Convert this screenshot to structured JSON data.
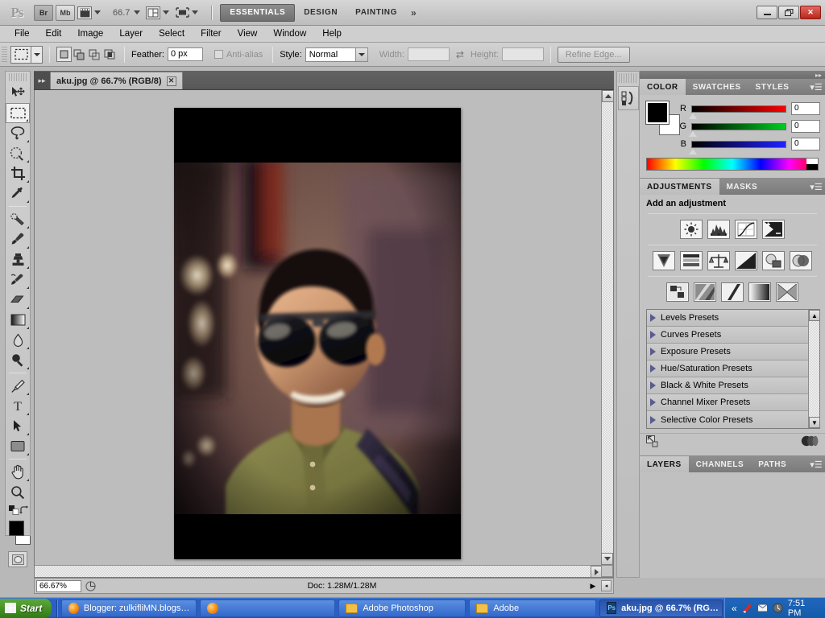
{
  "app": {
    "logo": "Ps",
    "quick_buttons": [
      {
        "name": "bridge",
        "label": "Br"
      },
      {
        "name": "mini-bridge",
        "label": "Mb"
      }
    ],
    "view_extras_label": "",
    "zoom_level": "66.7",
    "workspaces": [
      {
        "label": "ESSENTIALS",
        "active": true
      },
      {
        "label": "DESIGN",
        "active": false
      },
      {
        "label": "PAINTING",
        "active": false
      }
    ],
    "workspace_overflow": "»",
    "window_controls": {
      "minimize": "–",
      "restore": "❐",
      "close": "✕"
    }
  },
  "menubar": {
    "items": [
      "File",
      "Edit",
      "Image",
      "Layer",
      "Select",
      "Filter",
      "View",
      "Window",
      "Help"
    ]
  },
  "options_bar": {
    "tool": "rectangular-marquee",
    "selection_modes": [
      "new",
      "add",
      "subtract",
      "intersect"
    ],
    "feather_label": "Feather:",
    "feather_value": "0 px",
    "antialias_label": "Anti-alias",
    "antialias_checked": false,
    "style_label": "Style:",
    "style_value": "Normal",
    "width_label": "Width:",
    "width_value": "",
    "height_label": "Height:",
    "height_value": "",
    "swap_icon": "⇄",
    "refine_edge_label": "Refine Edge..."
  },
  "toolbox": {
    "tools": [
      {
        "name": "move-tool",
        "glyph": "move",
        "has_submenu": false,
        "selected": false
      },
      {
        "name": "rectangular-marquee-tool",
        "glyph": "marquee",
        "has_submenu": true,
        "selected": true
      },
      {
        "name": "lasso-tool",
        "glyph": "lasso",
        "has_submenu": true,
        "selected": false
      },
      {
        "name": "quick-selection-tool",
        "glyph": "quickselect",
        "has_submenu": true,
        "selected": false
      },
      {
        "name": "crop-tool",
        "glyph": "crop",
        "has_submenu": true,
        "selected": false
      },
      {
        "name": "eyedropper-tool",
        "glyph": "eyedropper",
        "has_submenu": true,
        "selected": false
      },
      {
        "name": "spot-healing-brush-tool",
        "glyph": "healing",
        "has_submenu": true,
        "selected": false
      },
      {
        "name": "brush-tool",
        "glyph": "brush",
        "has_submenu": true,
        "selected": false
      },
      {
        "name": "clone-stamp-tool",
        "glyph": "stamp",
        "has_submenu": true,
        "selected": false
      },
      {
        "name": "history-brush-tool",
        "glyph": "historybrush",
        "has_submenu": true,
        "selected": false
      },
      {
        "name": "eraser-tool",
        "glyph": "eraser",
        "has_submenu": true,
        "selected": false
      },
      {
        "name": "gradient-tool",
        "glyph": "gradient",
        "has_submenu": true,
        "selected": false
      },
      {
        "name": "blur-tool",
        "glyph": "blur",
        "has_submenu": true,
        "selected": false
      },
      {
        "name": "dodge-tool",
        "glyph": "dodge",
        "has_submenu": true,
        "selected": false
      },
      {
        "name": "pen-tool",
        "glyph": "pen",
        "has_submenu": true,
        "selected": false
      },
      {
        "name": "horizontal-type-tool",
        "glyph": "type",
        "has_submenu": true,
        "selected": false
      },
      {
        "name": "path-selection-tool",
        "glyph": "pathselect",
        "has_submenu": true,
        "selected": false
      },
      {
        "name": "rectangle-tool",
        "glyph": "shape",
        "has_submenu": true,
        "selected": false
      },
      {
        "name": "hand-tool",
        "glyph": "hand",
        "has_submenu": true,
        "selected": false
      },
      {
        "name": "zoom-tool",
        "glyph": "zoom",
        "has_submenu": false,
        "selected": false
      }
    ],
    "foreground_color": "#000000",
    "background_color": "#ffffff",
    "quick_mask_label": "quick-mask"
  },
  "document": {
    "tab_title": "aku.jpg @ 66.7% (RGB/8)",
    "tab_close": "✕",
    "collapse_glyph": "▸▸"
  },
  "statusbar": {
    "zoom": "66.67%",
    "doc_info": "Doc: 1.28M/1.28M",
    "play_glyph": "▶",
    "left_glyph": "◂"
  },
  "color_panel": {
    "tabs": [
      {
        "label": "COLOR",
        "active": true
      },
      {
        "label": "SWATCHES",
        "active": false
      },
      {
        "label": "STYLES",
        "active": false
      }
    ],
    "menu_glyph": "▾☰",
    "channels": [
      {
        "label": "R",
        "value": "0",
        "from": "#000000",
        "to": "#ff0000"
      },
      {
        "label": "G",
        "value": "0",
        "from": "#000000",
        "to": "#00ff00"
      },
      {
        "label": "B",
        "value": "0",
        "from": "#000000",
        "to": "#0000ff"
      }
    ],
    "foreground_color": "#000000",
    "background_color": "#ffffff"
  },
  "adjustments_panel": {
    "tabs": [
      {
        "label": "ADJUSTMENTS",
        "active": true
      },
      {
        "label": "MASKS",
        "active": false
      }
    ],
    "menu_glyph": "▾☰",
    "heading": "Add an adjustment",
    "rows": [
      [
        "brightness-contrast-icon",
        "levels-icon",
        "curves-icon",
        "exposure-icon"
      ],
      [
        "vibrance-icon",
        "hue-saturation-icon",
        "color-balance-icon",
        "black-white-icon",
        "photo-filter-icon",
        "channel-mixer-icon"
      ],
      [
        "invert-icon",
        "posterize-icon",
        "threshold-icon",
        "gradient-map-icon",
        "selective-color-icon"
      ]
    ],
    "presets": [
      "Levels Presets",
      "Curves Presets",
      "Exposure Presets",
      "Hue/Saturation Presets",
      "Black & White Presets",
      "Channel Mixer Presets",
      "Selective Color Presets"
    ],
    "scroll_up": "▲",
    "scroll_down": "▼",
    "footer_left_icon": "return-to-adjustment-list-icon",
    "footer_right_icon": "clip-to-layer-icon"
  },
  "layers_panel": {
    "tabs": [
      {
        "label": "LAYERS",
        "active": true
      },
      {
        "label": "CHANNELS",
        "active": false
      },
      {
        "label": "PATHS",
        "active": false
      }
    ],
    "menu_glyph": "▾☰"
  },
  "taskbar": {
    "start_label": "Start",
    "items": [
      {
        "name": "taskbar-item-blogger",
        "icon": "firefox-icon",
        "label": "Blogger: zulkifliMN.blogs…",
        "active": false
      },
      {
        "name": "taskbar-item-firefox-2",
        "icon": "firefox-icon",
        "label": "",
        "active": false
      },
      {
        "name": "taskbar-item-adobe-photoshop",
        "icon": "folder-icon",
        "label": "Adobe Photoshop",
        "active": false
      },
      {
        "name": "taskbar-item-adobe",
        "icon": "folder-icon",
        "label": "Adobe",
        "active": false
      },
      {
        "name": "taskbar-item-aku-jpg",
        "icon": "photoshop-icon",
        "label": "aku.jpg @ 66.7% (RG…",
        "active": true
      }
    ],
    "tray_expand": "«",
    "tray_icons": [
      "antivirus-icon",
      "messenger-icon",
      "clock-tool-icon"
    ],
    "clock": "7:51 PM"
  }
}
